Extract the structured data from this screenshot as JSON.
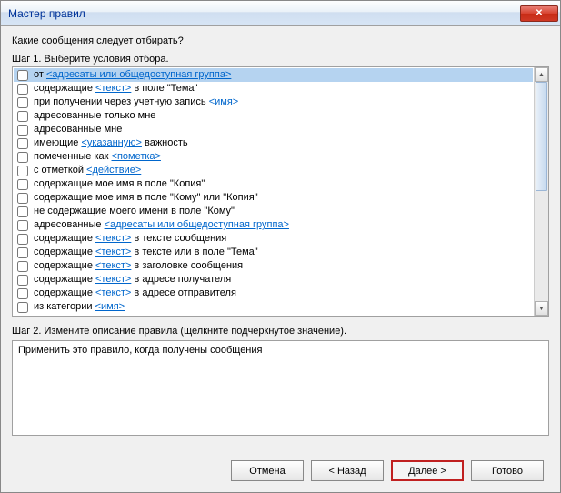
{
  "window": {
    "title": "Мастер правил",
    "close": "✕"
  },
  "question": "Какие сообщения следует отбирать?",
  "step1_label": "Шаг 1. Выберите условия отбора.",
  "step2_label": "Шаг 2. Измените описание правила (щелкните подчеркнутое значение).",
  "conditions": [
    {
      "selected": true,
      "checked": false,
      "parts": [
        "от ",
        {
          "link": "<адресаты или общедоступная группа>"
        }
      ]
    },
    {
      "selected": false,
      "checked": false,
      "parts": [
        "содержащие ",
        {
          "link": "<текст>"
        },
        " в поле \"Тема\""
      ]
    },
    {
      "selected": false,
      "checked": false,
      "parts": [
        "при получении через учетную запись ",
        {
          "link": "<имя>"
        }
      ]
    },
    {
      "selected": false,
      "checked": false,
      "parts": [
        "адресованные только мне"
      ]
    },
    {
      "selected": false,
      "checked": false,
      "parts": [
        "адресованные мне"
      ]
    },
    {
      "selected": false,
      "checked": false,
      "parts": [
        "имеющие ",
        {
          "link": "<указанную>"
        },
        " важность"
      ]
    },
    {
      "selected": false,
      "checked": false,
      "parts": [
        "помеченные как ",
        {
          "link": "<пометка>"
        }
      ]
    },
    {
      "selected": false,
      "checked": false,
      "parts": [
        "с отметкой ",
        {
          "link": "<действие>"
        }
      ]
    },
    {
      "selected": false,
      "checked": false,
      "parts": [
        "содержащие мое имя в поле \"Копия\""
      ]
    },
    {
      "selected": false,
      "checked": false,
      "parts": [
        "содержащие мое имя в поле \"Кому\" или \"Копия\""
      ]
    },
    {
      "selected": false,
      "checked": false,
      "parts": [
        "не содержащие моего имени в поле \"Кому\""
      ]
    },
    {
      "selected": false,
      "checked": false,
      "parts": [
        "адресованные ",
        {
          "link": "<адресаты или общедоступная группа>"
        }
      ]
    },
    {
      "selected": false,
      "checked": false,
      "parts": [
        "содержащие ",
        {
          "link": "<текст>"
        },
        " в тексте сообщения"
      ]
    },
    {
      "selected": false,
      "checked": false,
      "parts": [
        "содержащие ",
        {
          "link": "<текст>"
        },
        " в тексте или в поле \"Тема\""
      ]
    },
    {
      "selected": false,
      "checked": false,
      "parts": [
        "содержащие ",
        {
          "link": "<текст>"
        },
        " в заголовке сообщения"
      ]
    },
    {
      "selected": false,
      "checked": false,
      "parts": [
        "содержащие ",
        {
          "link": "<текст>"
        },
        " в адресе получателя"
      ]
    },
    {
      "selected": false,
      "checked": false,
      "parts": [
        "содержащие ",
        {
          "link": "<текст>"
        },
        " в адресе отправителя"
      ]
    },
    {
      "selected": false,
      "checked": false,
      "parts": [
        "из категории ",
        {
          "link": "<имя>"
        }
      ]
    }
  ],
  "description_text": "Применить это правило, когда получены сообщения",
  "buttons": {
    "cancel": "Отмена",
    "back": "< Назад",
    "next": "Далее >",
    "finish": "Готово"
  }
}
